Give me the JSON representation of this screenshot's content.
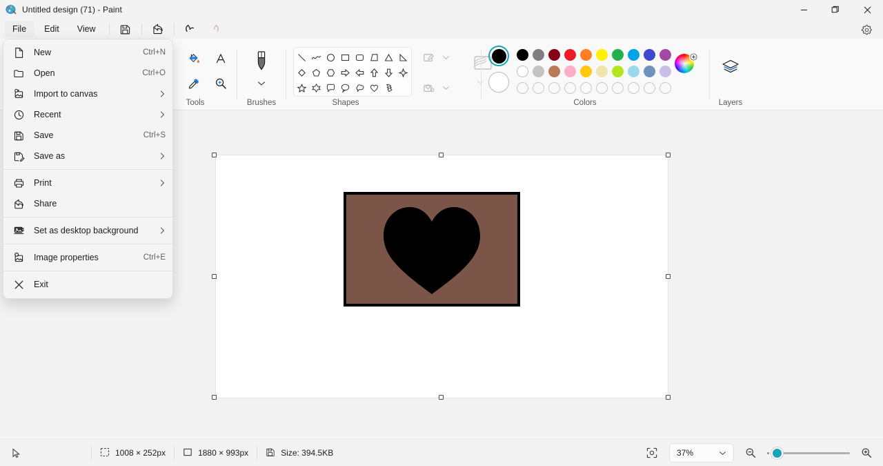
{
  "window": {
    "title": "Untitled design (71) - Paint",
    "app_icon": "paint-palette-icon",
    "controls": [
      {
        "name": "minimize",
        "glyph": "minimize-icon"
      },
      {
        "name": "maximize",
        "glyph": "restore-icon"
      },
      {
        "name": "close",
        "glyph": "close-icon"
      }
    ]
  },
  "menubar": {
    "items": [
      {
        "label": "File",
        "active": true
      },
      {
        "label": "Edit",
        "active": false
      },
      {
        "label": "View",
        "active": false
      }
    ],
    "buttons": [
      {
        "name": "save-button",
        "icon": "save-icon",
        "disabled": false
      },
      {
        "name": "share-button",
        "icon": "share-icon",
        "disabled": false
      },
      {
        "name": "undo-button",
        "icon": "undo-icon",
        "disabled": false
      },
      {
        "name": "redo-button",
        "icon": "redo-icon",
        "disabled": true
      }
    ],
    "settings": {
      "name": "settings-button",
      "icon": "gear-icon"
    }
  },
  "file_menu": {
    "items": [
      {
        "label": "New",
        "icon": "new-document-icon",
        "accel": "Ctrl+N",
        "submenu": false
      },
      {
        "label": "Open",
        "icon": "folder-icon",
        "accel": "Ctrl+O",
        "submenu": false
      },
      {
        "label": "Import to canvas",
        "icon": "import-image-icon",
        "accel": "",
        "submenu": true
      },
      {
        "label": "Recent",
        "icon": "clock-icon",
        "accel": "",
        "submenu": true
      },
      {
        "label": "Save",
        "icon": "save-icon",
        "accel": "Ctrl+S",
        "submenu": false
      },
      {
        "label": "Save as",
        "icon": "save-as-icon",
        "accel": "",
        "submenu": true
      },
      {
        "label": "Print",
        "icon": "printer-icon",
        "accel": "",
        "submenu": true,
        "divider_before": true
      },
      {
        "label": "Share",
        "icon": "share-icon",
        "accel": "",
        "submenu": false
      },
      {
        "label": "Set as desktop background",
        "icon": "desktop-background-icon",
        "accel": "",
        "submenu": true,
        "divider_before": true
      },
      {
        "label": "Image properties",
        "icon": "image-properties-icon",
        "accel": "Ctrl+E",
        "submenu": false,
        "divider_before": true
      },
      {
        "label": "Exit",
        "icon": "exit-icon",
        "accel": "",
        "submenu": false,
        "divider_before": true
      }
    ]
  },
  "ribbon": {
    "groups": [
      {
        "label": "Tools"
      },
      {
        "label": "Brushes"
      },
      {
        "label": "Shapes"
      },
      {
        "label": "Colors"
      },
      {
        "label": "Layers"
      }
    ],
    "tools": [
      {
        "name": "pencil-tool",
        "icon": "pencil-icon"
      },
      {
        "name": "fill-tool",
        "icon": "paint-bucket-icon"
      },
      {
        "name": "eraser-tool",
        "icon": "eraser-icon"
      },
      {
        "name": "text-tool",
        "icon": "text-a-icon"
      },
      {
        "name": "color-picker-tool",
        "icon": "eyedropper-icon"
      },
      {
        "name": "magnifier-tool",
        "icon": "magnifier-icon"
      }
    ],
    "brushes": {
      "name": "brush-button",
      "icon": "brush-icon",
      "chevron": "chevron-down-icon"
    },
    "shapes": [
      "line-shape",
      "curve-shape",
      "oval-shape",
      "rectangle-shape",
      "rounded-rectangle-shape",
      "right-triangle-shape",
      "triangle-shape",
      "four-point-triangle-shape",
      "diamond-shape",
      "pentagon-shape",
      "hexagon-shape",
      "right-arrow-shape",
      "left-arrow-shape",
      "up-arrow-shape",
      "down-arrow-shape",
      "four-point-star-shape",
      "five-point-star-shape",
      "six-point-star-shape",
      "rounded-callout-shape",
      "oval-callout-shape",
      "cloud-callout-shape",
      "heart-shape",
      "lightning-shape"
    ],
    "shape_options": [
      {
        "name": "outline-button",
        "icon": "outline-icon"
      },
      {
        "name": "fill-button",
        "icon": "fill-icon"
      },
      {
        "name": "shape-fill-preview",
        "icon": "shape-fill-icon"
      }
    ],
    "colors": {
      "primary": "#000000",
      "secondary": "#ffffff",
      "row1": [
        "#000000",
        "#7f7f7f",
        "#880015",
        "#ed1c24",
        "#ff7f27",
        "#fff200",
        "#22b14c",
        "#00a2e8",
        "#3f48cc",
        "#a349a4"
      ],
      "row2": [
        "#ffffff",
        "#c3c3c3",
        "#b97a57",
        "#ffaec9",
        "#ffc90e",
        "#efe4b0",
        "#b5e61d",
        "#99d9ea",
        "#7092be",
        "#c8bfe7"
      ],
      "row3": [
        "",
        "",
        "",
        "",
        "",
        "",
        "",
        "",
        "",
        ""
      ],
      "wheel": {
        "name": "color-picker-wheel",
        "icon": "color-wheel-icon"
      }
    },
    "layers": {
      "name": "layers-button",
      "icon": "layers-icon"
    }
  },
  "canvas": {
    "zoom_percent": "37%",
    "artwork": {
      "background_color": "#7a5548",
      "border_color": "#000000",
      "shape": "heart-shape",
      "shape_color": "#000000"
    }
  },
  "statusbar": {
    "cursor_icon": "cursor-arrow-icon",
    "selection_size": "1008 × 252px",
    "selection_icon": "selection-dashed-icon",
    "image_size": "1880 × 993px",
    "image_size_icon": "canvas-size-icon",
    "file_size": "Size: 394.5KB",
    "file_size_icon": "save-icon",
    "fit_button": {
      "name": "fit-to-window-button",
      "icon": "fit-screen-icon"
    },
    "zoom_value": "37%",
    "zoom_chevron": "chevron-down-icon",
    "zoom_out": "zoom-out-icon",
    "zoom_in": "zoom-in-icon"
  }
}
